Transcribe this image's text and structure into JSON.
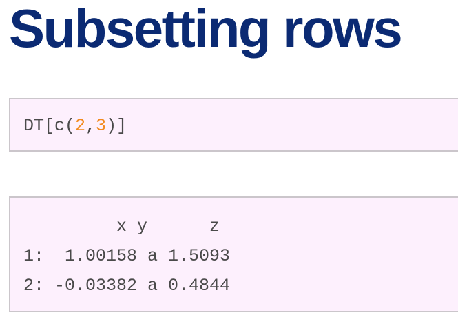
{
  "slide": {
    "title": "Subsetting rows"
  },
  "code": {
    "prefix": "DT[c(",
    "arg1": "2",
    "sep": ",",
    "arg2": "3",
    "suffix": ")]"
  },
  "output": {
    "lines": [
      "         x y      z",
      "1:  1.00158 a 1.5093",
      "2: -0.03382 a 0.4844"
    ]
  },
  "colors": {
    "title": "#0b2a73",
    "number": "#f28a1e",
    "code_bg": "#fdf0fd"
  }
}
